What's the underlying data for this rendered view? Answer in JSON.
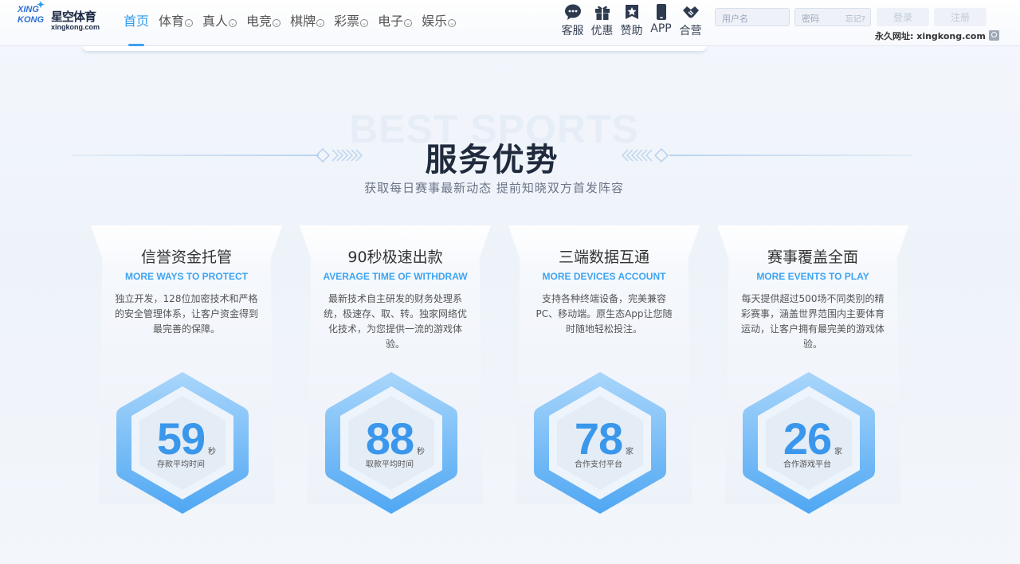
{
  "brand": {
    "mark_top": "XING",
    "mark_bottom": "KONG",
    "name_cn": "星空体育",
    "url": "xingkong.com"
  },
  "nav": {
    "items": [
      {
        "label": "首页",
        "dropdown": false,
        "active": true
      },
      {
        "label": "体育",
        "dropdown": true
      },
      {
        "label": "真人",
        "dropdown": true
      },
      {
        "label": "电竞",
        "dropdown": true
      },
      {
        "label": "棋牌",
        "dropdown": true
      },
      {
        "label": "彩票",
        "dropdown": true
      },
      {
        "label": "电子",
        "dropdown": true
      },
      {
        "label": "娱乐",
        "dropdown": true
      }
    ]
  },
  "quick_links": [
    {
      "label": "客服",
      "icon": "chat-icon"
    },
    {
      "label": "优惠",
      "icon": "gift-icon"
    },
    {
      "label": "赞助",
      "icon": "star-badge-icon"
    },
    {
      "label": "APP",
      "icon": "phone-icon"
    },
    {
      "label": "合营",
      "icon": "handshake-icon"
    }
  ],
  "login": {
    "username_placeholder": "用户名",
    "password_placeholder": "密码",
    "forgot": "忘记?",
    "login_label": "登录",
    "register_label": "注册"
  },
  "permanent_url": "永久网址: xingkong.com",
  "section": {
    "bg_word": "BEST SPORTS",
    "title": "服务优势",
    "subtitle": "获取每日赛事最新动态  提前知晓双方首发阵容"
  },
  "cards": [
    {
      "title": "信誉资金托管",
      "subtitle": "MORE WAYS TO PROTECT",
      "desc": "独立开发，128位加密技术和严格的安全管理体系，让客户资金得到最完善的保障。",
      "stat": "59",
      "unit": "秒",
      "stat_label": "存款平均时间"
    },
    {
      "title": "90秒极速出款",
      "subtitle": "AVERAGE TIME OF WITHDRAW",
      "desc": "最新技术自主研发的财务处理系统，极速存、取、转。独家网络优化技术，为您提供一流的游戏体验。",
      "stat": "88",
      "unit": "秒",
      "stat_label": "取款平均时间"
    },
    {
      "title": "三端数据互通",
      "subtitle": "MORE DEVICES ACCOUNT",
      "desc": "支持各种终端设备，完美兼容PC、移动端。原生态App让您随时随地轻松投注。",
      "stat": "78",
      "unit": "家",
      "stat_label": "合作支付平台"
    },
    {
      "title": "赛事覆盖全面",
      "subtitle": "MORE EVENTS TO PLAY",
      "desc": "每天提供超过500场不同类别的精彩赛事，涵盖世界范围内主要体育运动，让客户拥有最完美的游戏体验。",
      "stat": "26",
      "unit": "家",
      "stat_label": "合作游戏平台"
    }
  ],
  "colors": {
    "accent": "#2f9cf0",
    "stat_blue": "#3a97eb",
    "hex_ring": "#6bb5f5",
    "title": "#1f2a3c"
  }
}
